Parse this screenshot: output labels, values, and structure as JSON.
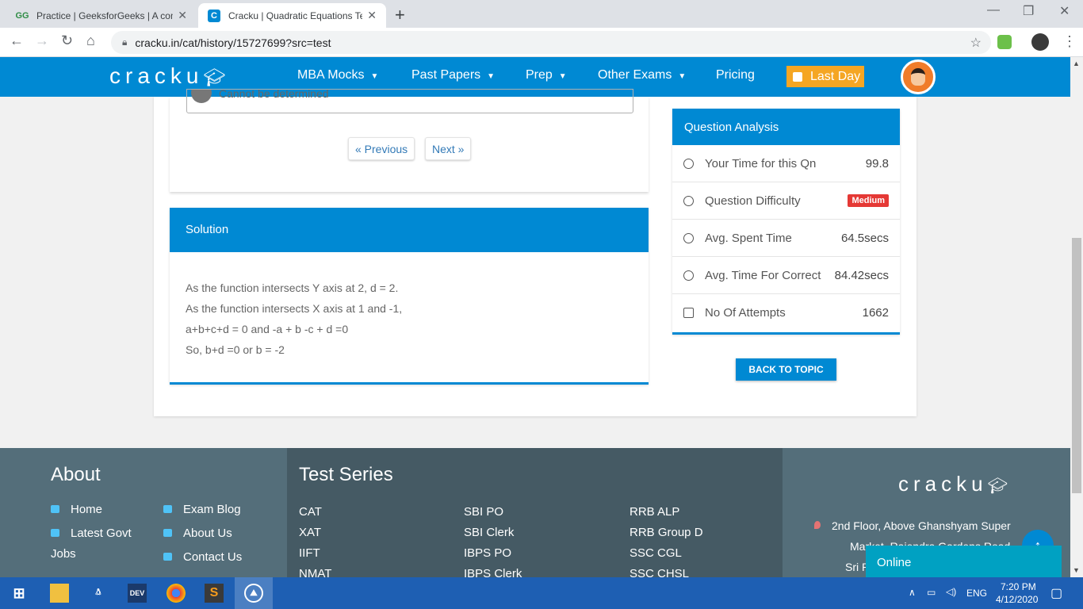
{
  "browser": {
    "tabs": [
      {
        "label": "Practice | GeeksforGeeks | A comp",
        "favicon": "GG"
      },
      {
        "label": "Cracku | Quadratic Equations Tes",
        "favicon": "C"
      }
    ],
    "url": "cracku.in/cat/history/15727699?src=test"
  },
  "header": {
    "logo": "cracku",
    "nav": [
      "MBA Mocks",
      "Past Papers",
      "Prep",
      "Other Exams",
      "Pricing"
    ],
    "cta": "Last Day"
  },
  "question": {
    "option_text": "Cannot be determined",
    "prev_label": "« Previous",
    "next_label": "Next »"
  },
  "solution": {
    "title": "Solution",
    "lines": [
      "As the function intersects Y axis at 2, d = 2.",
      "As the function intersects X axis at 1 and -1,",
      "a+b+c+d = 0 and -a + b -c + d =0",
      "So, b+d =0 or b = -2"
    ]
  },
  "analysis": {
    "title": "Question Analysis",
    "rows": [
      {
        "label": "Your Time for this Qn",
        "value": "99.8",
        "icon": "stopwatch-icon"
      },
      {
        "label": "Question Difficulty",
        "value": "Medium",
        "icon": "question-circle-icon"
      },
      {
        "label": "Avg. Spent Time",
        "value": "64.5secs",
        "icon": "clock-icon"
      },
      {
        "label": "Avg. Time For Correct",
        "value": "84.42secs",
        "icon": "alarm-icon"
      },
      {
        "label": "No Of Attempts",
        "value": "1662",
        "icon": "edit-icon"
      }
    ],
    "back_label": "BACK TO TOPIC",
    "difficulty_color": "#e53935"
  },
  "footer": {
    "about_title": "About",
    "about_links": [
      "Home",
      "Exam Blog",
      "Latest Govt",
      "About Us",
      "Jobs",
      "Contact Us"
    ],
    "test_title": "Test Series",
    "tests": [
      "CAT",
      "SBI PO",
      "RRB ALP",
      "XAT",
      "SBI Clerk",
      "RRB Group D",
      "IIFT",
      "IBPS PO",
      "SSC CGL",
      "NMAT",
      "IBPS Clerk",
      "SSC CHSL"
    ],
    "logo": "cracku",
    "address_line1": "2nd Floor, Above Ghanshyam Super",
    "address_line2": "Market, Rajendra Gardens Road",
    "address_line3": "Sri R",
    "online_label": "Online"
  },
  "taskbar": {
    "lang": "ENG",
    "time": "7:20 PM",
    "date": "4/12/2020"
  },
  "colors": {
    "brand": "#0089d3",
    "cta": "#f5a623"
  }
}
